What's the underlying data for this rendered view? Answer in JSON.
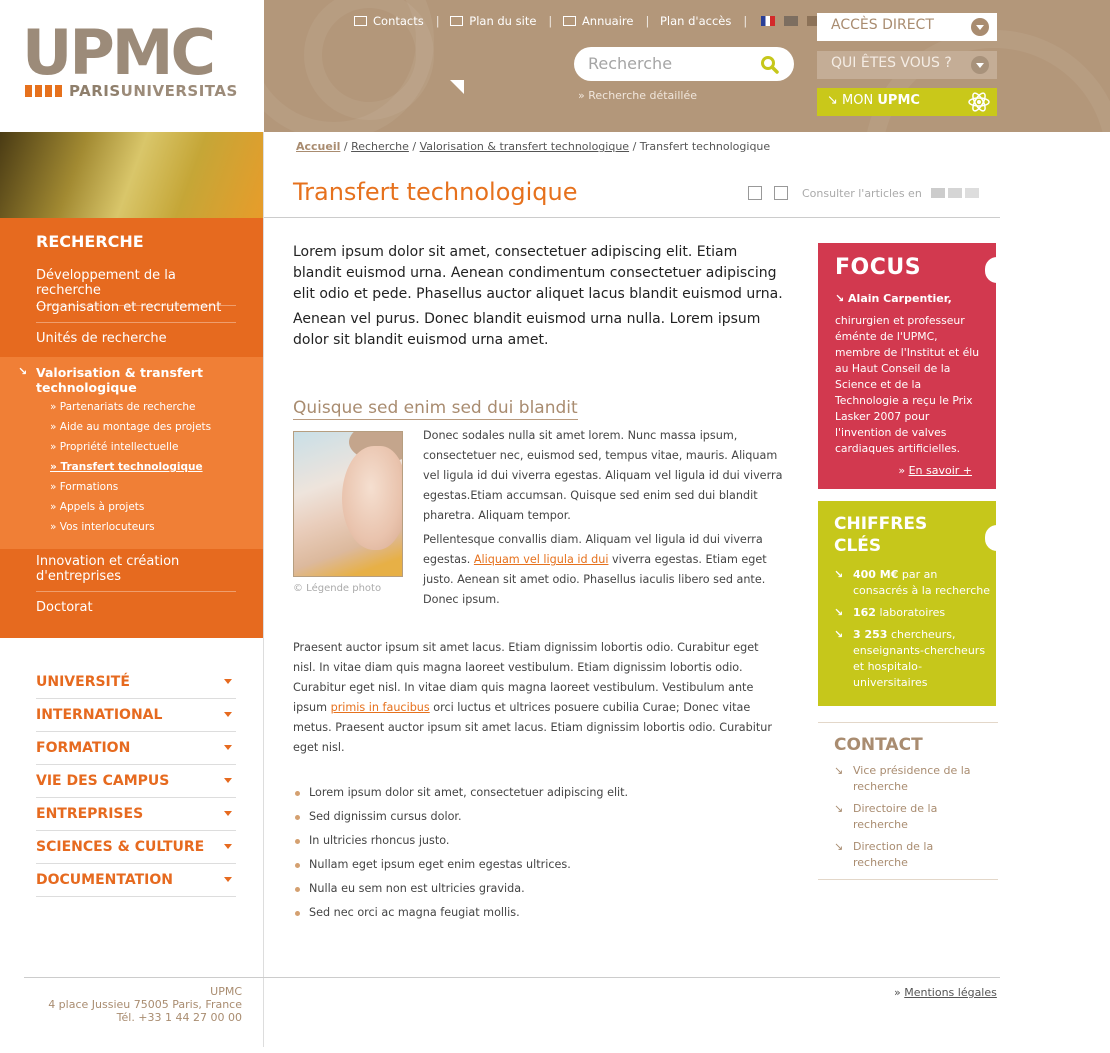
{
  "header": {
    "logo_main": "UPMC",
    "logo_sub_1": "PARIS",
    "logo_sub_2": "UNIVERSITAS",
    "top_links": [
      "Contacts",
      "Plan du site",
      "Annuaire",
      "Plan d'accès"
    ],
    "languages": [
      "fr",
      "en",
      "es",
      "de"
    ],
    "search_placeholder": "Recherche",
    "search_advanced": "» Recherche détaillée",
    "btn_acces": "ACCÈS DIRECT",
    "btn_qui": "QUI ÊTES VOUS ?",
    "btn_mon_1": "MON",
    "btn_mon_2": "UPMC"
  },
  "left_nav": {
    "section_title": "RECHERCHE",
    "items": [
      "Développement de la recherche",
      "Organisation et recrutement",
      "Unités de recherche"
    ],
    "active_title": "Valorisation & transfert technologique",
    "sub_items": [
      "Partenariats de recherche",
      "Aide au montage des projets",
      "Propriété intellectuelle",
      "Transfert technologique",
      "Formations",
      "Appels à projets",
      "Vos interlocuteurs"
    ],
    "items_after": [
      "Innovation et création d'entreprises",
      "Doctorat"
    ]
  },
  "lower_nav": [
    "UNIVERSITÉ",
    "INTERNATIONAL",
    "FORMATION",
    "VIE DES CAMPUS",
    "ENTREPRISES",
    "SCIENCES & CULTURE",
    "DOCUMENTATION"
  ],
  "breadcrumb": [
    "Accueil",
    "Recherche",
    "Valorisation & transfert technologique",
    "Transfert technologique"
  ],
  "page_title": "Transfert technologique",
  "tools_label": "Consulter l'articles en",
  "intro": [
    "Lorem ipsum dolor sit amet, consectetuer adipiscing elit. Etiam blandit euismod urna. Aenean condimentum consectetuer adipiscing elit odio et pede. Phasellus auctor aliquet lacus blandit euismod urna.",
    "Aenean vel purus. Donec blandit euismod urna nulla. Lorem ipsum dolor sit blandit euismod urna amet."
  ],
  "subheading": "Quisque sed enim sed dui blandit",
  "photo_caption": "© Légende photo",
  "body_p1": "Donec sodales nulla sit amet lorem. Nunc massa ipsum, consectetuer nec, euismod sed, tempus vitae, mauris. Aliquam vel ligula id dui viverra egestas. Aliquam vel ligula id dui viverra egestas.Etiam accumsan. Quisque sed enim sed dui blandit pharetra. Aliquam tempor.",
  "body_p2_a": "Pellentesque convallis diam. Aliquam vel ligula id dui viverra egestas. ",
  "body_p2_link": "Aliquam vel ligula id dui",
  "body_p2_b": " viverra egestas. Etiam eget justo. Aenean sit amet odio. Phasellus iaculis libero sed ante. Donec ipsum.",
  "para2_a": "Praesent auctor ipsum sit amet lacus. Etiam dignissim lobortis odio. Curabitur eget nisl. In vitae diam quis magna laoreet vestibulum. Etiam dignissim lobortis odio. Curabitur eget nisl. In vitae diam quis magna laoreet vestibulum. Vestibulum ante ipsum ",
  "para2_link": "primis in faucibus",
  "para2_b": " orci luctus et ultrices posuere cubilia Curae; Donec vitae metus. Praesent auctor ipsum sit amet lacus. Etiam dignissim lobortis odio. Curabitur eget nisl.",
  "bullets": [
    "Lorem ipsum dolor sit amet, consectetuer adipiscing elit.",
    "Sed dignissim cursus dolor.",
    "In ultricies rhoncus justo.",
    "Nullam eget ipsum eget enim egestas ultrices.",
    "Nulla eu sem non est ultricies gravida.",
    "Sed nec orci ac magna feugiat mollis."
  ],
  "focus": {
    "title": "FOCUS",
    "name": "Alain Carpentier,",
    "desc": "chirurgien et professeur éménte de l'UPMC, membre de l'Institut et élu au Haut Conseil de la Science et de la Technologie a reçu le Prix Lasker 2007 pour l'invention de valves cardiaques artificielles.",
    "more": "En savoir +"
  },
  "chiffres": {
    "title_1": "CHIFFRES",
    "title_2": "CLÉS",
    "items": [
      {
        "num": "400 M€",
        "text": " par an consacrés à la recherche"
      },
      {
        "num": "162",
        "text": " laboratoires"
      },
      {
        "num": "3 253",
        "text": " chercheurs, enseignants-chercheurs et hospitalo-universitaires"
      }
    ]
  },
  "contact": {
    "title": "CONTACT",
    "items": [
      "Vice présidence de la recherche",
      "Directoire de la recherche",
      "Direction de la recherche"
    ]
  },
  "footer": {
    "addr_1": "UPMC",
    "addr_2": "4 place Jussieu 75005 Paris, France",
    "addr_3": "Tél. +33 1 44 27 00 00",
    "legal": "Mentions légales"
  },
  "colors": {
    "orange": "#e66a1f",
    "tan": "#b3977a",
    "focus_red": "#d2394f",
    "chiffres_green": "#c6c71b"
  }
}
